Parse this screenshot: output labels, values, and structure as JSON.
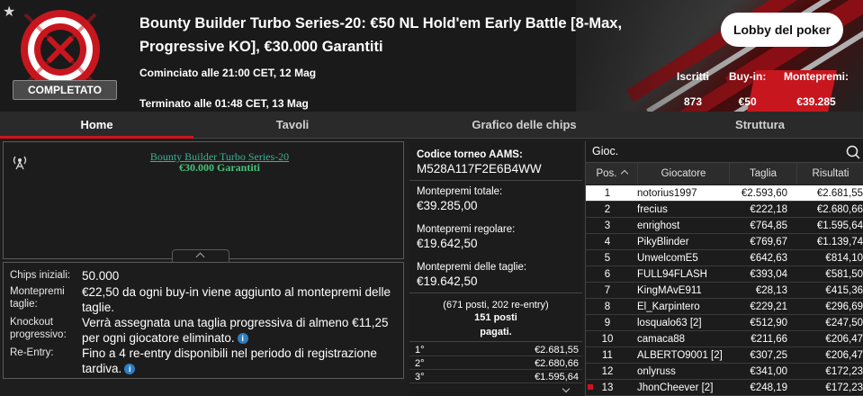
{
  "header": {
    "title": "Bounty Builder Turbo Series-20: €50 NL Hold'em Early Battle [8-Max, Progressive KO], €30.000 Garantiti",
    "status_badge": "COMPLETATO",
    "started": "Cominciato alle 21:00 CET, 12 Mag",
    "ended": "Terminato alle 01:48 CET, 13 Mag",
    "lobby_button": "Lobby del poker",
    "stats": [
      {
        "label": "Iscritti",
        "value": "873"
      },
      {
        "label": "Buy-in:",
        "value": "€50"
      },
      {
        "label": "Montepremi:",
        "value": "€39.285"
      }
    ]
  },
  "tabs": [
    {
      "label": "Home",
      "active": true
    },
    {
      "label": "Tavoli",
      "active": false
    },
    {
      "label": "Grafico delle chips",
      "active": false
    },
    {
      "label": "Struttura",
      "active": false
    }
  ],
  "description": {
    "line1": "Bounty Builder Turbo Series-20",
    "line2": "€30.000 Garantiti"
  },
  "info": [
    {
      "label": "Chips iniziali:",
      "value": "50.000"
    },
    {
      "label": "Montepremi taglie:",
      "value": "€22,50 da ogni buy-in viene aggiunto al montepremi delle taglie."
    },
    {
      "label": "Knockout progressivo:",
      "value": "Verrà assegnata una taglia progressiva di almeno €11,25 per ogni giocatore eliminato."
    },
    {
      "label": "Re-Entry:",
      "value": "Fino a 4 re-entry disponibili nel periodo di registrazione tardiva."
    }
  ],
  "summary": {
    "aams_label": "Codice torneo AAMS:",
    "aams_value": "M528A117F2E6B4WW",
    "total_label": "Montepremi totale:",
    "total_value": "€39.285,00",
    "regular_label": "Montepremi regolare:",
    "regular_value": "€19.642,50",
    "bounty_label": "Montepremi delle taglie:",
    "bounty_value": "€19.642,50",
    "posti_line1": "(671 posti, 202 re-entry)",
    "posti_line2": "151 posti",
    "posti_line3": "pagati.",
    "prizes": [
      {
        "place": "1°",
        "amount": "€2.681,55"
      },
      {
        "place": "2°",
        "amount": "€2.680,66"
      },
      {
        "place": "3°",
        "amount": "€1.595,64"
      }
    ]
  },
  "players": {
    "search_label": "Gioc.",
    "columns": [
      "Pos.",
      "Giocatore",
      "Taglia",
      "Risultati"
    ],
    "rows": [
      {
        "pos": "1",
        "name": "notorius1997",
        "stack": "€2.593,60",
        "result": "€2.681,55"
      },
      {
        "pos": "2",
        "name": "frecius",
        "stack": "€222,18",
        "result": "€2.680,66"
      },
      {
        "pos": "3",
        "name": "enrighost",
        "stack": "€764,85",
        "result": "€1.595,64"
      },
      {
        "pos": "4",
        "name": "PikyBlinder",
        "stack": "€769,67",
        "result": "€1.139,74"
      },
      {
        "pos": "5",
        "name": "UnwelcomE5",
        "stack": "€642,63",
        "result": "€814,10"
      },
      {
        "pos": "6",
        "name": "FULL94FLASH",
        "stack": "€393,04",
        "result": "€581,50"
      },
      {
        "pos": "7",
        "name": "KingMAvE911",
        "stack": "€28,13",
        "result": "€415,36"
      },
      {
        "pos": "8",
        "name": "El_Karpintero",
        "stack": "€229,21",
        "result": "€296,69"
      },
      {
        "pos": "9",
        "name": "losqualo63 [2]",
        "stack": "€512,90",
        "result": "€247,50"
      },
      {
        "pos": "10",
        "name": "camaca88",
        "stack": "€211,66",
        "result": "€206,47"
      },
      {
        "pos": "11",
        "name": "ALBERTO9001 [2]",
        "stack": "€307,25",
        "result": "€206,47"
      },
      {
        "pos": "12",
        "name": "onlyruss",
        "stack": "€341,00",
        "result": "€172,23"
      },
      {
        "pos": "13",
        "name": "JhonCheever [2]",
        "stack": "€248,19",
        "result": "€172,23"
      }
    ]
  },
  "icons": {
    "star": "star-icon",
    "antenna": "antenna-icon",
    "info": "info-icon",
    "search": "search-icon"
  },
  "colors": {
    "accent": "#d0141d",
    "link": "#3bb08f",
    "info_icon": "#2f7fc0"
  }
}
